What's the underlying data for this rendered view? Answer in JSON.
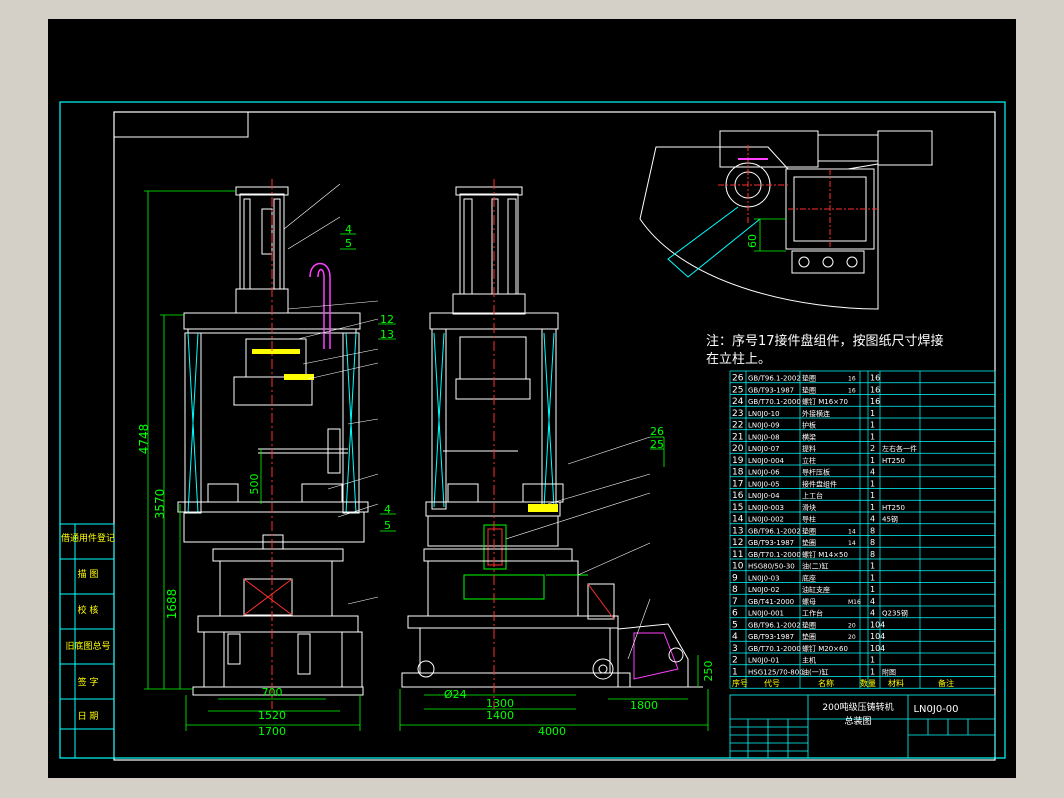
{
  "note": {
    "line1": "注：序号17接件盘组件，按图纸尺寸焊接",
    "line2": "在立柱上。"
  },
  "dims": {
    "d4748": "4748",
    "d3570": "3570",
    "d1688": "1688",
    "d500": "500",
    "d700": "700",
    "d1520": "1520",
    "d1700": "1700",
    "d24": "Ø24",
    "d1300": "1300",
    "d1400": "1400",
    "d4000": "4000",
    "d1800": "1800",
    "d250": "250",
    "d60": "60"
  },
  "callouts": {
    "c4a": "4",
    "c5a": "5",
    "c12": "12",
    "c13": "13",
    "c4b": "4",
    "c5b": "5",
    "c26": "26",
    "c25": "25"
  },
  "left_labels": [
    "借通用件登记",
    "描  图",
    "校  核",
    "旧底图总号",
    "签  字",
    "日  期"
  ],
  "bom_rows": [
    [
      "26",
      "GB/T96.1-2002",
      "垫圈",
      "16",
      "16",
      ""
    ],
    [
      "25",
      "GB/T93-1987",
      "垫圈",
      "16",
      "16",
      ""
    ],
    [
      "24",
      "GB/T70.1-2000",
      "螺钉 M16×70",
      "",
      "16",
      ""
    ],
    [
      "23",
      "LN0J0-10",
      "外接横连",
      "",
      "1",
      ""
    ],
    [
      "22",
      "LN0J0-09",
      "护板",
      "",
      "1",
      ""
    ],
    [
      "21",
      "LN0J0-08",
      "横梁",
      "",
      "1",
      ""
    ],
    [
      "20",
      "LN0J0-07",
      "提料",
      "",
      "2",
      "左右各一件"
    ],
    [
      "19",
      "LN0J0-004",
      "立柱",
      "",
      "1",
      "HT250"
    ],
    [
      "18",
      "LN0J0-06",
      "导杆压板",
      "",
      "4",
      ""
    ],
    [
      "17",
      "LN0J0-05",
      "接件盘组件",
      "",
      "1",
      ""
    ],
    [
      "16",
      "LN0J0-04",
      "上工台",
      "",
      "1",
      ""
    ],
    [
      "15",
      "LN0J0-003",
      "滑块",
      "",
      "1",
      "HT250"
    ],
    [
      "14",
      "LN0J0-002",
      "导柱",
      "",
      "4",
      "45钢"
    ],
    [
      "13",
      "GB/T96.1-2002",
      "垫圈",
      "14",
      "8",
      ""
    ],
    [
      "12",
      "GB/T93-1987",
      "垫圈",
      "14",
      "8",
      ""
    ],
    [
      "11",
      "GB/T70.1-2000",
      "螺钉 M14×50",
      "",
      "8",
      ""
    ],
    [
      "10",
      "HSG80/50-30",
      "油(二)缸",
      "",
      "1",
      ""
    ],
    [
      "9",
      "LN0J0-03",
      "底座",
      "",
      "1",
      ""
    ],
    [
      "8",
      "LN0J0-02",
      "油缸支座",
      "",
      "1",
      ""
    ],
    [
      "7",
      "GB/T41-2000",
      "螺母",
      "M16",
      "4",
      ""
    ],
    [
      "6",
      "LN0J0-001",
      "工作台",
      "",
      "4",
      "Q235钢"
    ],
    [
      "5",
      "GB/T96.1-2002",
      "垫圈",
      "20",
      "104",
      ""
    ],
    [
      "4",
      "GB/T93-1987",
      "垫圈",
      "20",
      "104",
      ""
    ],
    [
      "3",
      "GB/T70.1-2000",
      "螺钉 M20×60",
      "",
      "104",
      ""
    ],
    [
      "2",
      "LN0J0-01",
      "主机",
      "",
      "1",
      ""
    ],
    [
      "1",
      "HSG125/70-800",
      "油(一)缸",
      "",
      "1",
      "附图"
    ]
  ],
  "bom_header": [
    "序号",
    "代号",
    "名称",
    "数量",
    "材料",
    "备注"
  ],
  "title_block": {
    "title1": "200吨级压铸转机",
    "title2": "总装图",
    "drawing_no": "LN0J0-00"
  },
  "colors": {
    "line": "#00ffff",
    "white": "#ffffff",
    "red": "#ff3030",
    "magenta": "#ff40ff",
    "yellow": "#ffff00",
    "green": "#00ff00"
  }
}
